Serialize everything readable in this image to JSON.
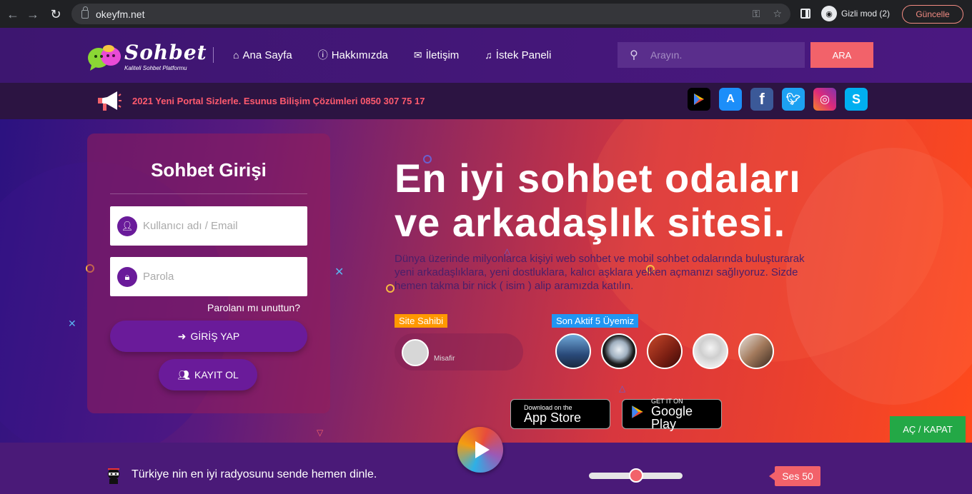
{
  "browser": {
    "url": "okeyfm.net",
    "incognito_label": "Gizli mod (2)",
    "update_label": "Güncelle"
  },
  "header": {
    "logo_name": "Sohbet",
    "logo_tagline": "Kaliteli Sohbet Platformu",
    "menu": [
      {
        "label": "Ana Sayfa",
        "icon": "home-icon"
      },
      {
        "label": "Hakkımızda",
        "icon": "info-icon"
      },
      {
        "label": "İletişim",
        "icon": "envelope-icon"
      },
      {
        "label": "İstek Paneli",
        "icon": "music-icon"
      }
    ],
    "search_placeholder": "Arayın.",
    "search_button": "ARA"
  },
  "announcement": {
    "text": "2021 Yeni Portal Sizlerle. Esunus Bilişim Çözümleri 0850 307 75 17"
  },
  "socials": [
    {
      "name": "google-play",
      "color": "#000000"
    },
    {
      "name": "app-store",
      "color": "#1c8ef9"
    },
    {
      "name": "facebook",
      "color": "#3b5998"
    },
    {
      "name": "twitter",
      "color": "#1da1f2"
    },
    {
      "name": "instagram",
      "color": "#c13584"
    },
    {
      "name": "skype",
      "color": "#00aff0"
    }
  ],
  "login": {
    "title": "Sohbet Girişi",
    "username_placeholder": "Kullanıcı adı / Email",
    "password_placeholder": "Parola",
    "forgot": "Parolanı mı unuttun?",
    "login_button": "GİRİŞ YAP",
    "register_button": "KAYIT OL"
  },
  "hero": {
    "headline_line1": "En iyi sohbet odaları",
    "headline_line2": "ve arkadaşlık sitesi.",
    "subtext": "Dünya üzerinde milyonlarca kişiyi web sohbet ve mobil sohbet odalarında buluşturarak yeni arkadaşlıklara, yeni dostluklara, kalıcı aşklara yelken açmanızı sağlıyoruz. Sizde hemen takma bir nick ( isim ) alip aramızda katılın.",
    "owner_badge": "Site Sahibi",
    "owner_name": "Misafir",
    "members_badge": "Son Aktif 5 Üyemiz",
    "appstore_small": "Download on the",
    "appstore_large": "App Store",
    "googleplay_small": "GET IT ON",
    "googleplay_large": "Google Play",
    "toggle_button": "AÇ / KAPAT"
  },
  "colors": {
    "accent": "#f2626a",
    "purple": "#6a1b9a",
    "badge_owner": "#ff9800",
    "badge_members": "#2196f3",
    "toggle_green": "#23a846"
  },
  "radio": {
    "text": "Türkiye nin en iyi radyosunu sende hemen dinle.",
    "volume_label": "Ses 50",
    "volume_value": 50
  }
}
